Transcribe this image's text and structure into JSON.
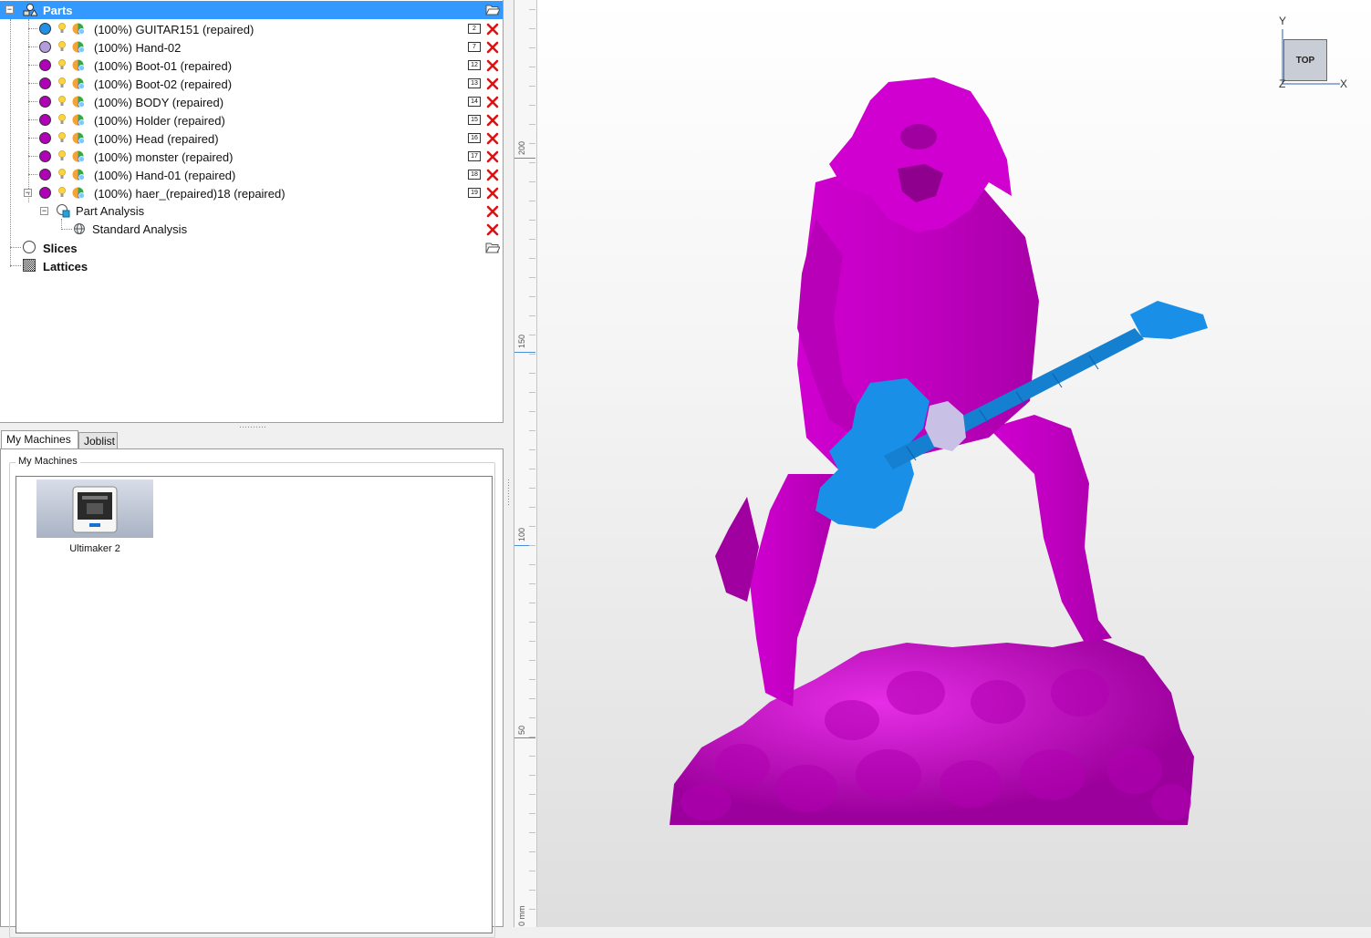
{
  "tree": {
    "root_label": "Parts",
    "parts": [
      {
        "label": "(100%) GUITAR151 (repaired)",
        "num": "2",
        "color": "#1e90e6"
      },
      {
        "label": "(100%) Hand-02",
        "num": "7",
        "color": "#b39ddb"
      },
      {
        "label": "(100%) Boot-01 (repaired)",
        "num": "12",
        "color": "#b000b8"
      },
      {
        "label": "(100%) Boot-02 (repaired)",
        "num": "13",
        "color": "#b000b8"
      },
      {
        "label": "(100%) BODY (repaired)",
        "num": "14",
        "color": "#b000b8"
      },
      {
        "label": "(100%) Holder (repaired)",
        "num": "15",
        "color": "#b000b8"
      },
      {
        "label": "(100%) Head (repaired)",
        "num": "16",
        "color": "#b000b8"
      },
      {
        "label": "(100%) monster (repaired)",
        "num": "17",
        "color": "#b000b8"
      },
      {
        "label": "(100%) Hand-01 (repaired)",
        "num": "18",
        "color": "#b000b8"
      },
      {
        "label": "(100%) haer_(repaired)18 (repaired)",
        "num": "19",
        "color": "#b000b8"
      }
    ],
    "part_analysis_label": "Part Analysis",
    "standard_analysis_label": "Standard Analysis",
    "slices_label": "Slices",
    "lattices_label": "Lattices"
  },
  "tabs": {
    "my_machines": "My Machines",
    "joblist": "Joblist"
  },
  "machines": {
    "group_title": "My Machines",
    "items": [
      {
        "label": "Ultimaker 2"
      }
    ]
  },
  "viewport": {
    "ruler_labels": [
      "200",
      "150",
      "100",
      "50",
      "0 mm"
    ],
    "view_cube_label": "TOP",
    "axis_y": "Y",
    "axis_x": "X",
    "axis_z": "Z",
    "model_colors": {
      "figure": "#c800c8",
      "guitar": "#1a8fe8",
      "hand": "#c9c0e6"
    }
  }
}
